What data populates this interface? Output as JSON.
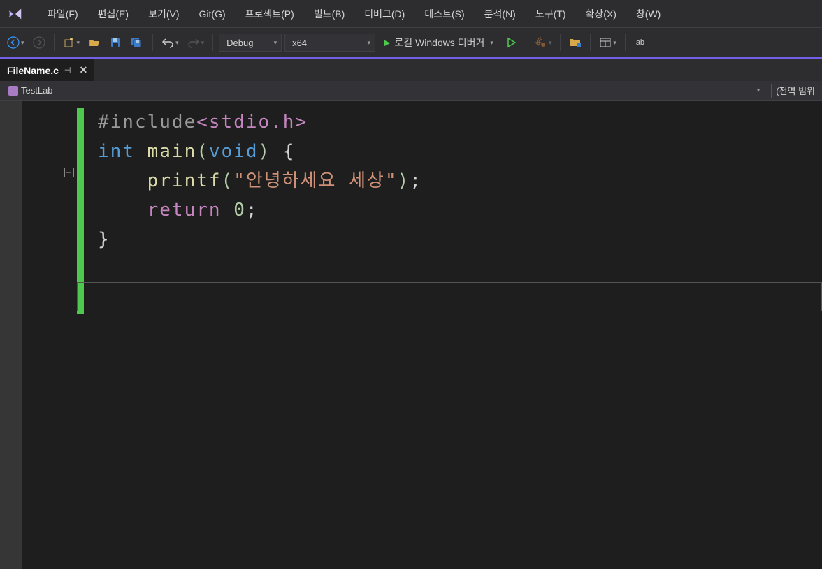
{
  "menu": {
    "items": [
      "파일(F)",
      "편집(E)",
      "보기(V)",
      "Git(G)",
      "프로젝트(P)",
      "빌드(B)",
      "디버그(D)",
      "테스트(S)",
      "분석(N)",
      "도구(T)",
      "확장(X)",
      "창(W)"
    ]
  },
  "toolbar": {
    "config": "Debug",
    "platform": "x64",
    "run_label": "로컬 Windows 디버거"
  },
  "tab": {
    "filename": "FileName.c"
  },
  "context": {
    "project": "TestLab",
    "scope": "(전역 범위"
  },
  "code": {
    "line1": {
      "hash_include": "#include",
      "angle_open": "<",
      "header": "stdio.h",
      "angle_close": ">"
    },
    "line2_blank": "",
    "line3": {
      "int": "int",
      "main": " main",
      "paren_open": "(",
      "void": "void",
      "paren_close": ")",
      "brace_open": " {"
    },
    "line4_blank": "",
    "line5": {
      "indent": "    ",
      "printf": "printf",
      "paren_open": "(",
      "string": "\"안녕하세요 세상\"",
      "paren_close": ")",
      "semi": ";"
    },
    "line6": {
      "indent": "    ",
      "return": "return",
      "space": " ",
      "zero": "0",
      "semi": ";"
    },
    "line7": {
      "brace_close": "}"
    }
  },
  "fold_symbol": "−"
}
